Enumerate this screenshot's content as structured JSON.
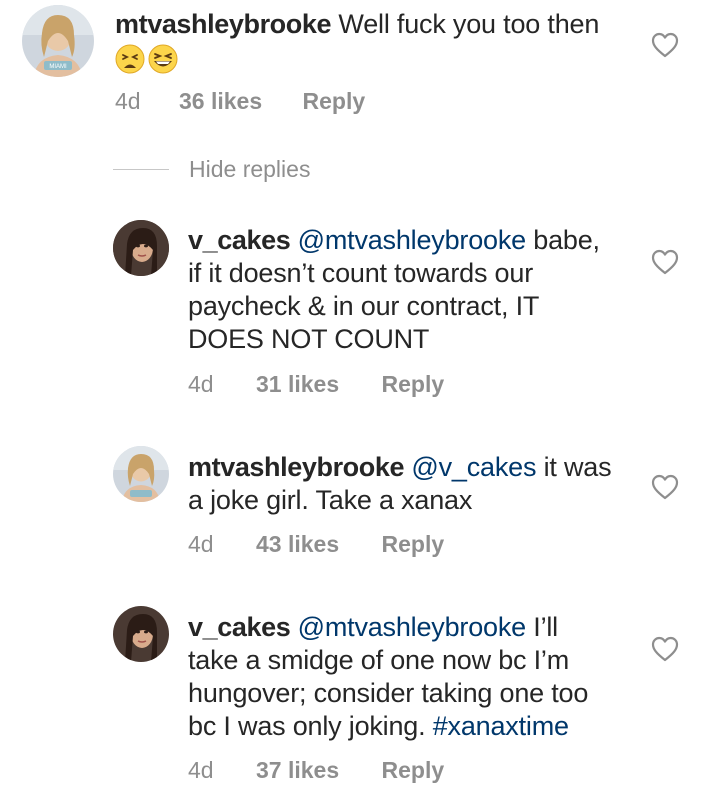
{
  "colors": {
    "text": "#262626",
    "meta": "#8e8e8e",
    "link": "#00376b",
    "divider": "#c7c7c7",
    "heart_stroke": "#8e8e8e"
  },
  "comments": [
    {
      "username": "mtvashleybrooke",
      "text": "Well fuck you too then",
      "emojis": [
        "tired-face-emoji",
        "grinning-squinting-face-emoji"
      ],
      "age": "4d",
      "likes": "36 likes",
      "reply": "Reply"
    },
    {
      "username": "v_cakes",
      "mention": "@mtvashleybrooke",
      "line1_rest": "babe,",
      "line2": "if it doesn’t count towards our",
      "line3": "paycheck & in our contract, IT",
      "line4": "DOES NOT COUNT",
      "age": "4d",
      "likes": "31 likes",
      "reply": "Reply"
    },
    {
      "username": "mtvashleybrooke",
      "mention": "@v_cakes",
      "line1_rest": "it was",
      "line2": "a joke girl. Take a xanax",
      "age": "4d",
      "likes": "43 likes",
      "reply": "Reply"
    },
    {
      "username": "v_cakes",
      "mention": "@mtvashleybrooke",
      "line1_rest": "I’ll",
      "line2": "take a smidge of one now bc I’m",
      "line3": "hungover; consider taking one too",
      "line4_text": "bc I was only joking.",
      "hashtag": "#xanaxtime",
      "age": "4d",
      "likes": "37 likes",
      "reply": "Reply"
    }
  ],
  "hide_replies": "Hide replies",
  "icons": {
    "heart": "heart-outline-icon"
  }
}
